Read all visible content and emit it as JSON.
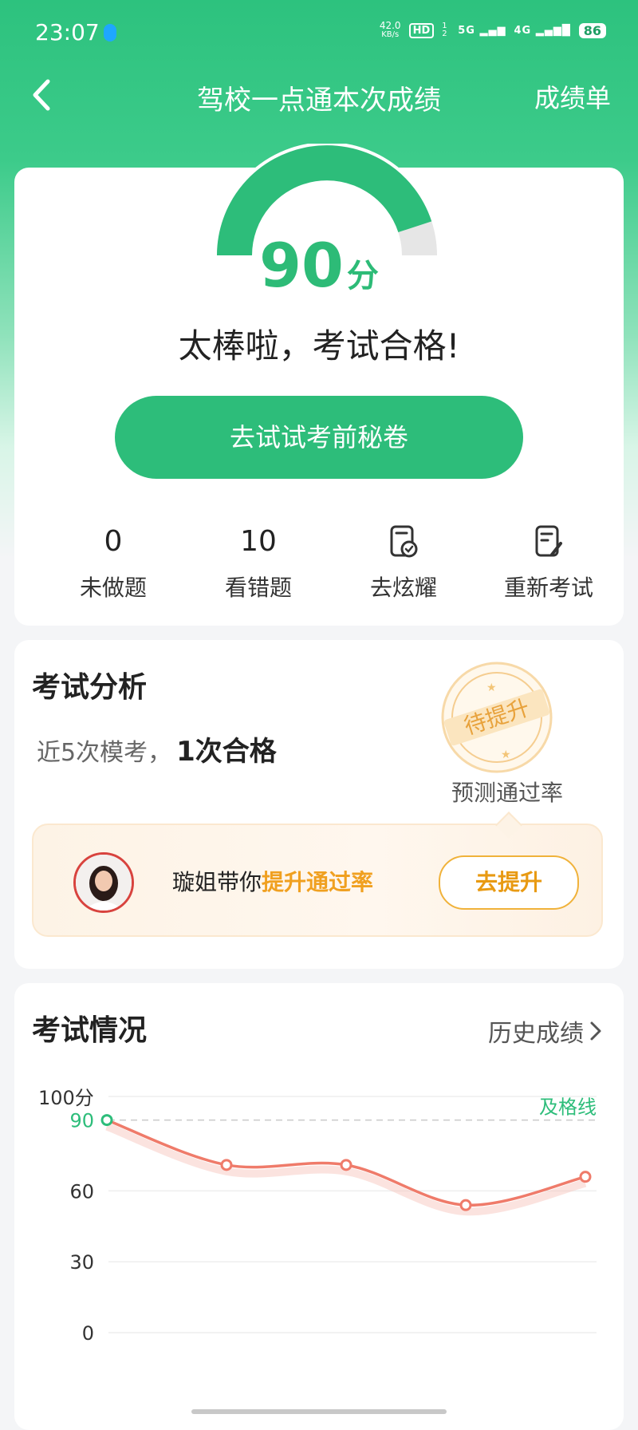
{
  "status_bar": {
    "time": "23:07",
    "net_speed_value": "42.0",
    "net_speed_unit": "KB/s",
    "hd": "HD",
    "hd_sub": "1 2",
    "sig1": "5G",
    "sig2": "4G",
    "battery": "86"
  },
  "nav": {
    "title": "驾校一点通本次成绩",
    "right_label": "成绩单"
  },
  "result": {
    "score": "90",
    "score_unit": "分",
    "score_fraction": 0.9,
    "message": "太棒啦，考试合格!",
    "cta": "去试试考前秘卷",
    "accent": "#2dbd7a"
  },
  "quick_actions": [
    {
      "value": "0",
      "label": "未做题"
    },
    {
      "value": "10",
      "label": "看错题"
    },
    {
      "icon": "share-badge-icon",
      "label": "去炫耀"
    },
    {
      "icon": "retake-exam-icon",
      "label": "重新考试"
    }
  ],
  "analysis": {
    "title": "考试分析",
    "recent_prefix": "近5次模考，",
    "recent_strong": "1次合格",
    "stamp_text": "待提升",
    "predict_label": "预测通过率",
    "promo_prefix": "璇姐带你",
    "promo_highlight": "提升通过率",
    "promo_button": "去提升",
    "highlight_color": "#f0a020"
  },
  "exam_history": {
    "title": "考试情况",
    "link": "历史成绩"
  },
  "chart_data": {
    "type": "line",
    "ylabel": "",
    "ymax_label": "100分",
    "pass_label": "及格线",
    "pass_line": 90,
    "ylim": [
      0,
      100
    ],
    "yticks": [
      {
        "value": 90,
        "label": "90"
      },
      {
        "value": 60,
        "label": "60"
      },
      {
        "value": 30,
        "label": "30"
      },
      {
        "value": 0,
        "label": "0"
      }
    ],
    "series": [
      {
        "values": [
          90,
          71,
          71,
          54,
          66
        ]
      }
    ],
    "colors": {
      "line": "#ef7b6a",
      "pass": "#2dbd7a",
      "first_point": "#2dbd7a"
    }
  }
}
